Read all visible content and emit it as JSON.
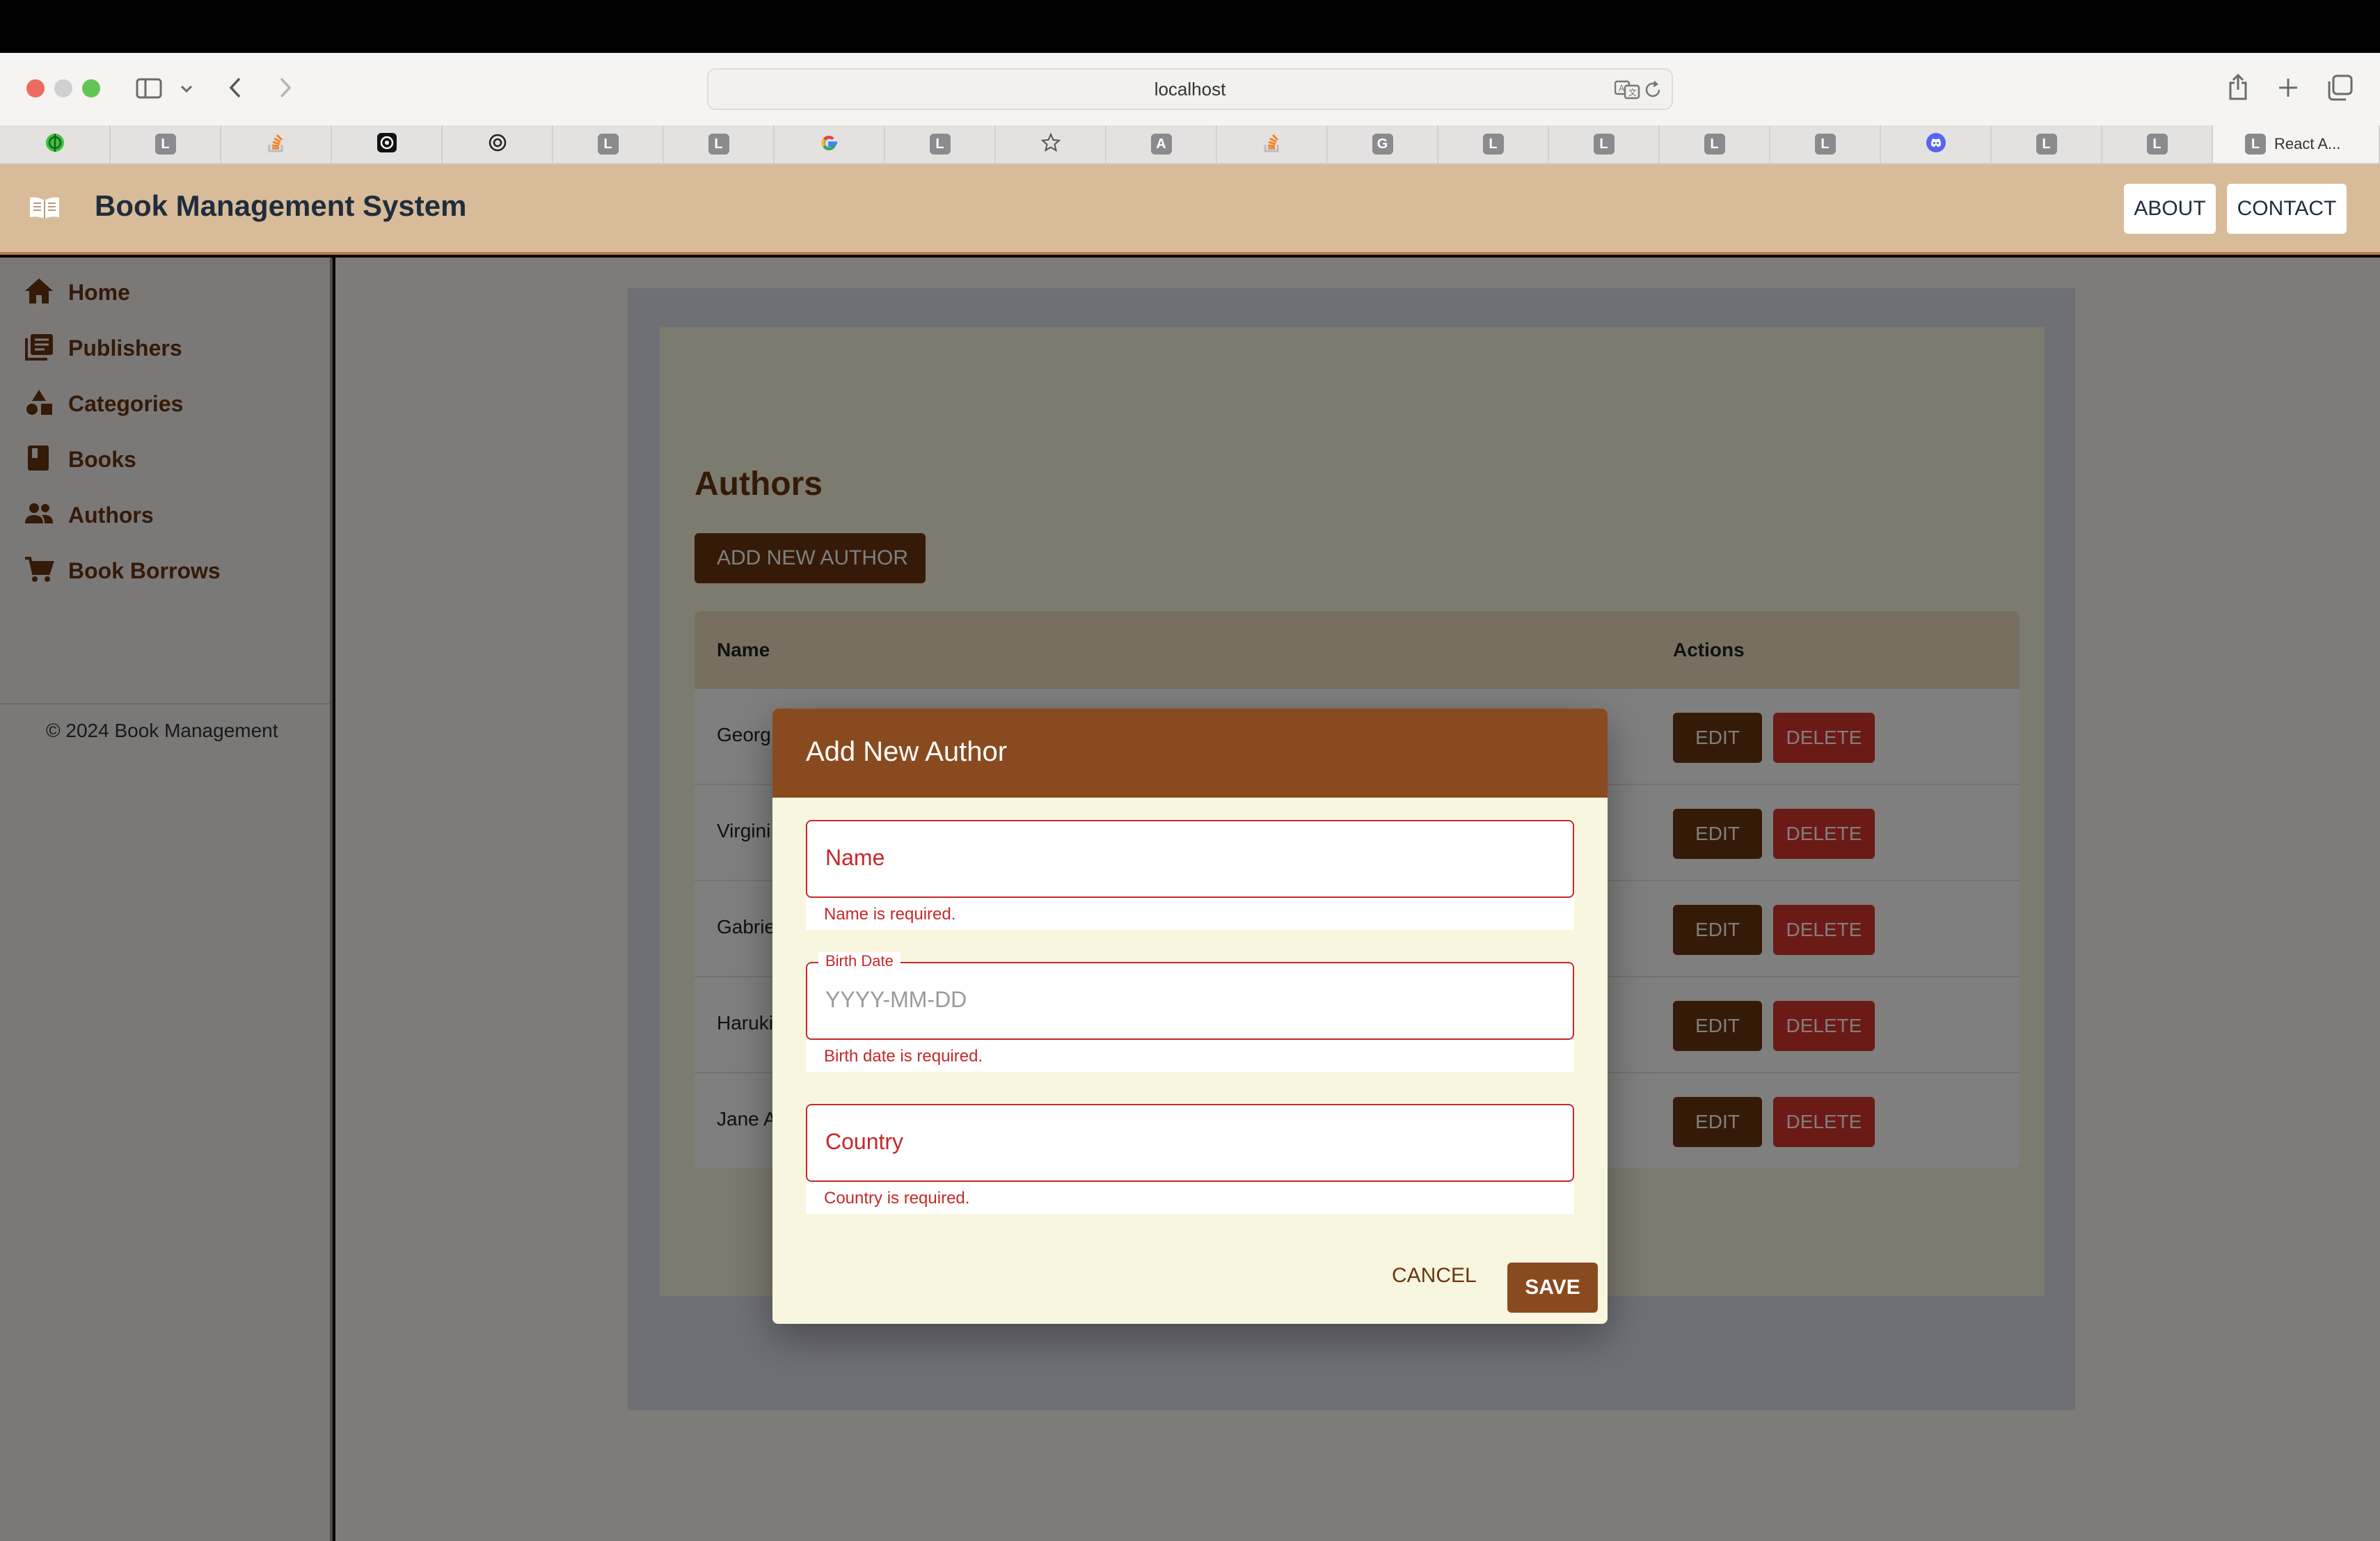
{
  "browser": {
    "url": "localhost",
    "tabs": [
      {
        "icon": "green-globe-icon"
      },
      {
        "letter": "L"
      },
      {
        "icon": "stack-overflow-icon"
      },
      {
        "icon": "chatgpt-icon"
      },
      {
        "icon": "openai-icon"
      },
      {
        "letter": "L"
      },
      {
        "letter": "L"
      },
      {
        "icon": "google-icon"
      },
      {
        "letter": "L"
      },
      {
        "icon": "star-icon"
      },
      {
        "letter": "A"
      },
      {
        "icon": "stack-overflow-icon"
      },
      {
        "letter": "G"
      },
      {
        "letter": "L"
      },
      {
        "letter": "L"
      },
      {
        "letter": "L"
      },
      {
        "letter": "L"
      },
      {
        "icon": "discord-icon"
      },
      {
        "letter": "L"
      },
      {
        "letter": "L"
      }
    ],
    "active_tab": {
      "letter": "L",
      "title": "React A..."
    }
  },
  "app": {
    "title": "Book Management System",
    "header_buttons": {
      "about": "ABOUT",
      "contact": "CONTACT"
    }
  },
  "sidebar": {
    "items": [
      {
        "label": "Home",
        "icon": "home-icon"
      },
      {
        "label": "Publishers",
        "icon": "library-icon"
      },
      {
        "label": "Categories",
        "icon": "category-shapes-icon"
      },
      {
        "label": "Books",
        "icon": "book-icon"
      },
      {
        "label": "Authors",
        "icon": "people-icon"
      },
      {
        "label": "Book Borrows",
        "icon": "cart-icon"
      }
    ],
    "copyright": "© 2024 Book Management"
  },
  "authors_page": {
    "title": "Authors",
    "add_button": "ADD NEW AUTHOR",
    "columns": {
      "name": "Name",
      "actions": "Actions"
    },
    "rows": [
      {
        "name": "Georg"
      },
      {
        "name": "Virgini"
      },
      {
        "name": "Gabrie"
      },
      {
        "name": "Haruki"
      },
      {
        "name": "Jane A"
      }
    ],
    "edit_label": "EDIT",
    "delete_label": "DELETE"
  },
  "dialog": {
    "title": "Add New Author",
    "name_label": "Name",
    "name_error": "Name is required.",
    "birth_label": "Birth Date",
    "birth_placeholder": "YYYY-MM-DD",
    "birth_error": "Birth date is required.",
    "country_label": "Country",
    "country_error": "Country is required.",
    "cancel": "CANCEL",
    "save": "SAVE"
  },
  "colors": {
    "brand_brown": "#6b3510",
    "dialog_header": "#8a4a1f",
    "error_red": "#c62828",
    "delete_red": "#d9342b",
    "header_tan": "#d8bb99"
  }
}
